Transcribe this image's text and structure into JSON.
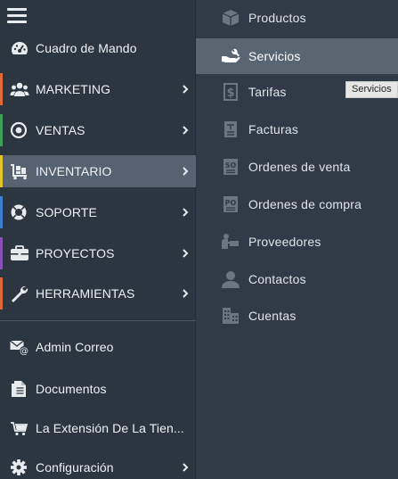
{
  "colors": {
    "sidebar_bg": "#2c3641",
    "submenu_bg": "#313b47",
    "active_bg": "#566270",
    "marketing": "#e06a3b",
    "ventas": "#3fa05a",
    "inventario": "#e2c32a",
    "soporte": "#3f7fcf",
    "proyectos": "#8a4fb3",
    "herramientas": "#d9683a"
  },
  "sidebar": {
    "menu_icon": "hamburger-icon",
    "items": [
      {
        "label": "Cuadro de Mando",
        "icon": "dashboard-icon"
      },
      {
        "label": "MARKETING",
        "icon": "users-icon"
      },
      {
        "label": "VENTAS",
        "icon": "target-icon"
      },
      {
        "label": "INVENTARIO",
        "icon": "cart-dolly-icon"
      },
      {
        "label": "SOPORTE",
        "icon": "lifebuoy-icon"
      },
      {
        "label": "PROYECTOS",
        "icon": "briefcase-icon"
      },
      {
        "label": "HERRAMIENTAS",
        "icon": "wrench-icon"
      }
    ],
    "bottom_items": [
      {
        "label": "Admin Correo",
        "icon": "mail-at-icon"
      },
      {
        "label": "Documentos",
        "icon": "document-icon"
      },
      {
        "label": "La Extensión De La Tien...",
        "icon": "shopping-cart-icon"
      },
      {
        "label": "Configuración",
        "icon": "gear-icon"
      }
    ]
  },
  "submenu": {
    "items": [
      {
        "label": "Productos",
        "icon": "box-icon"
      },
      {
        "label": "Servicios",
        "icon": "hand-wrench-icon"
      },
      {
        "label": "Tarifas",
        "icon": "price-tag-icon"
      },
      {
        "label": "Facturas",
        "icon": "invoice-icon"
      },
      {
        "label": "Ordenes de venta",
        "icon": "sales-order-icon"
      },
      {
        "label": "Ordenes de compra",
        "icon": "purchase-order-icon"
      },
      {
        "label": "Proveedores",
        "icon": "supplier-icon"
      },
      {
        "label": "Contactos",
        "icon": "contact-icon"
      },
      {
        "label": "Cuentas",
        "icon": "building-icon"
      }
    ]
  },
  "tooltip": {
    "text": "Servicios"
  }
}
